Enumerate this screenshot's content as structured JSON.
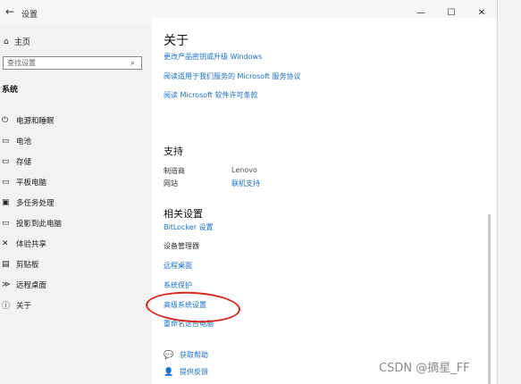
{
  "window": {
    "title": "设置",
    "controls": [
      "—",
      "☐",
      "✕"
    ]
  },
  "sidebar": {
    "home": "主页",
    "search_placeholder": "查找设置",
    "section": "系统",
    "items": [
      {
        "label": "电源和睡眠",
        "icon": "power-icon",
        "glyph": "⏻"
      },
      {
        "label": "电池",
        "icon": "battery-icon",
        "glyph": "▭"
      },
      {
        "label": "存储",
        "icon": "storage-icon",
        "glyph": "▭"
      },
      {
        "label": "平板电脑",
        "icon": "tablet-icon",
        "glyph": "▭"
      },
      {
        "label": "多任务处理",
        "icon": "multitask-icon",
        "glyph": "▣"
      },
      {
        "label": "投影到此电脑",
        "icon": "projection-icon",
        "glyph": "▭"
      },
      {
        "label": "体验共享",
        "icon": "share-icon",
        "glyph": "✕"
      },
      {
        "label": "剪贴板",
        "icon": "clipboard-icon",
        "glyph": "▤"
      },
      {
        "label": "远程桌面",
        "icon": "remote-desktop-icon",
        "glyph": "≫"
      },
      {
        "label": "关于",
        "icon": "info-icon",
        "glyph": "ⓘ"
      }
    ]
  },
  "main": {
    "title": "关于",
    "links_top": [
      "更改产品密钥或升级 Windows",
      "阅读适用于我们服务的 Microsoft 服务协议",
      "阅读 Microsoft 软件许可条款"
    ],
    "support": {
      "heading": "支持",
      "manufacturer_label": "制造商",
      "manufacturer_value": "Lenovo",
      "website_label": "网站",
      "website_value": "联机支持"
    },
    "related": {
      "heading": "相关设置",
      "bitlocker": "BitLocker 设置",
      "device_manager": "设备管理器",
      "remote_desktop": "远程桌面",
      "system_protection": "系统保护",
      "advanced_settings": "高级系统设置",
      "rename_pc": "重命名这台电脑"
    },
    "help": {
      "get_help": "获取帮助",
      "feedback": "提供反馈"
    }
  },
  "watermark": "CSDN @摘星_FF",
  "colors": {
    "link": "#1a6fc4",
    "annotation": "#d9261c"
  }
}
